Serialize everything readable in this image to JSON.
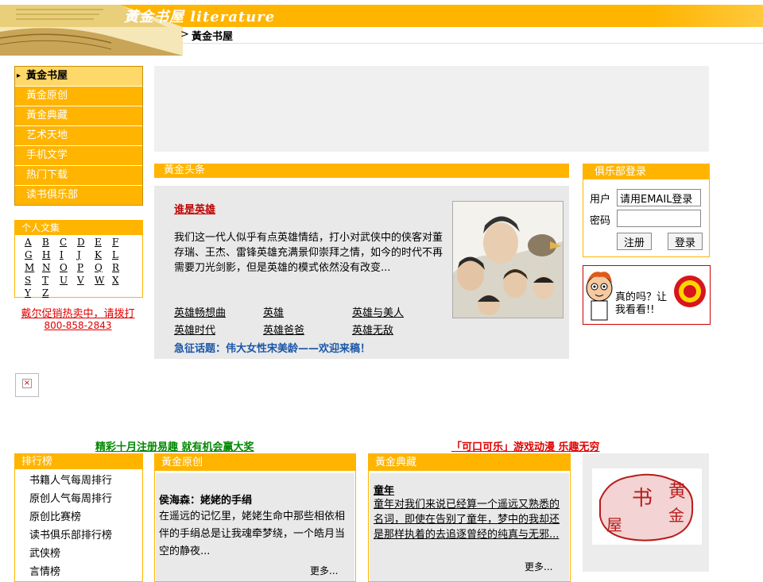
{
  "header": {
    "logo_title": "黃金书屋 literature",
    "breadcrumb_arrow": ">",
    "breadcrumb": "黃金书屋"
  },
  "nav": {
    "items": [
      {
        "label": "黃金书屋",
        "active": true
      },
      {
        "label": "黃金原创",
        "active": false
      },
      {
        "label": "黃金典藏",
        "active": false
      },
      {
        "label": "艺术天地",
        "active": false
      },
      {
        "label": "手机文学",
        "active": false
      },
      {
        "label": "热门下载",
        "active": false
      },
      {
        "label": "读书俱乐部",
        "active": false
      }
    ]
  },
  "personal_works": {
    "title": "个人文集",
    "letters": [
      "A",
      "B",
      "C",
      "D",
      "E",
      "F",
      "G",
      "H",
      "I",
      "J",
      "K",
      "L",
      "M",
      "N",
      "O",
      "P",
      "Q",
      "R",
      "S",
      "T",
      "U",
      "V",
      "W",
      "X",
      "Y",
      "Z"
    ]
  },
  "promo": {
    "line1": "戴尔促销热卖中，请拨打",
    "line2": "800-858-2843"
  },
  "headline": {
    "section": "黃金头条",
    "title": "谁是英雄",
    "text": "我们这一代人似乎有点英雄情结，打小对武侠中的侠客对董存瑞、王杰、雷锋英雄充满景仰崇拜之情，如今的时代不再需要刀光剑影，但是英雄的模式依然没有改变...",
    "links": [
      "英雄畅想曲",
      "英雄",
      "英雄与美人",
      "英雄时代",
      "英雄爸爸",
      "英雄无敌"
    ],
    "topic": "急征话题：伟大女性宋美龄——欢迎来稿！"
  },
  "club": {
    "title": "俱乐部登录",
    "user_label": "用户",
    "user_value": "请用EMAIL登录",
    "password_label": "密码",
    "password_value": "",
    "register_label": "注册",
    "login_label": "登录"
  },
  "cartoon": {
    "speech": "真的吗？让我看看!!"
  },
  "promos": {
    "green": "精彩十月注册易趣 就有机会赢大奖",
    "red": "「可口可乐」游戏动漫 乐趣无穷"
  },
  "rankings": {
    "title": "排行榜",
    "items": [
      "书籍人气每周排行",
      "原创人气每周排行",
      "原创比赛榜",
      "读书俱乐部排行榜",
      "武侠榜",
      "言情榜"
    ]
  },
  "original": {
    "title": "黃金原创",
    "article_title": "侯海森：姥姥的手绢",
    "article_text": "在遥远的记忆里，姥姥生命中那些相依相伴的手绢总是让我魂牵梦绕，一个皓月当空的静夜...",
    "more": "更多..."
  },
  "classic": {
    "title": "黃金典藏",
    "article_title": "童年",
    "article_text": "童年对我们来说已经算一个遥远又熟悉的名词，即使在告别了童年，梦中的我却还是那样执着的去追逐曾经的纯真与无邪...",
    "more": "更多..."
  },
  "seal": {
    "chars": [
      "黄",
      "金",
      "书",
      "屋"
    ]
  },
  "colors": {
    "accent": "#ffb400",
    "link_red": "#e00000",
    "link_green": "#008800",
    "topic_blue": "#1a57a8"
  }
}
